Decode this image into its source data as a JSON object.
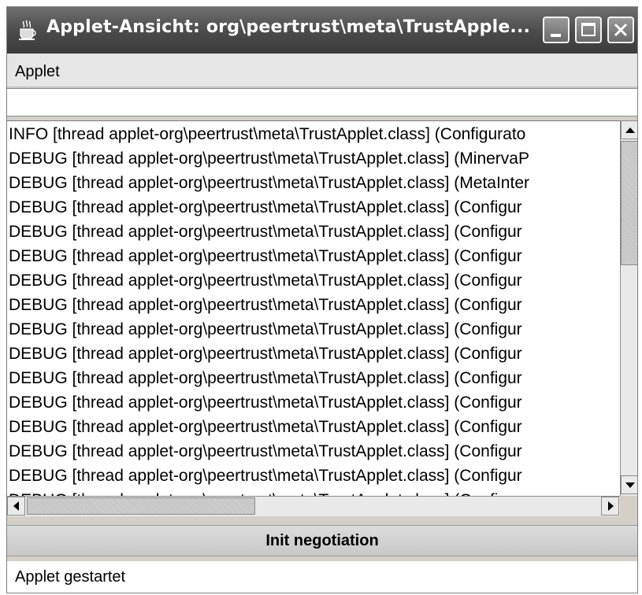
{
  "window": {
    "title": "Applet-Ansicht: org\\peertrust\\meta\\TrustApple...",
    "icons": {
      "app": "applet-coffee-icon",
      "minimize": "minimize-icon",
      "maximize": "maximize-icon",
      "close": "close-icon"
    }
  },
  "menubar": {
    "items": [
      {
        "label": "Applet"
      }
    ]
  },
  "input": {
    "value": ""
  },
  "log": {
    "lines": [
      "INFO  [thread applet-org\\peertrust\\meta\\TrustApplet.class] (Configurato",
      "DEBUG [thread applet-org\\peertrust\\meta\\TrustApplet.class] (MinervaP",
      "DEBUG [thread applet-org\\peertrust\\meta\\TrustApplet.class] (MetaInter",
      "DEBUG [thread applet-org\\peertrust\\meta\\TrustApplet.class] (Configur",
      "DEBUG [thread applet-org\\peertrust\\meta\\TrustApplet.class] (Configur",
      "DEBUG [thread applet-org\\peertrust\\meta\\TrustApplet.class] (Configur",
      "DEBUG [thread applet-org\\peertrust\\meta\\TrustApplet.class] (Configur",
      "DEBUG [thread applet-org\\peertrust\\meta\\TrustApplet.class] (Configur",
      "DEBUG [thread applet-org\\peertrust\\meta\\TrustApplet.class] (Configur",
      "DEBUG [thread applet-org\\peertrust\\meta\\TrustApplet.class] (Configur",
      "DEBUG [thread applet-org\\peertrust\\meta\\TrustApplet.class] (Configur",
      "DEBUG [thread applet-org\\peertrust\\meta\\TrustApplet.class] (Configur",
      "DEBUG [thread applet-org\\peertrust\\meta\\TrustApplet.class] (Configur",
      "DEBUG [thread applet-org\\peertrust\\meta\\TrustApplet.class] (Configur",
      "DEBUG [thread applet-org\\peertrust\\meta\\TrustApplet.class] (Configur",
      "DEBUG [thread applet-org\\peertrust\\meta\\TrustApplet.class] (Configur"
    ]
  },
  "scrollbars": {
    "vertical": {
      "icons": {
        "up": "scroll-up-arrow-icon",
        "down": "scroll-down-arrow-icon"
      }
    },
    "horizontal": {
      "icons": {
        "left": "scroll-left-arrow-icon",
        "right": "scroll-right-arrow-icon"
      }
    }
  },
  "actions": {
    "init_label": "Init negotiation"
  },
  "status": {
    "text": "Applet gestartet"
  },
  "colors": {
    "titlebar": "#4a4a4a",
    "window_bg": "#d4d0c8",
    "text": "#000000"
  }
}
